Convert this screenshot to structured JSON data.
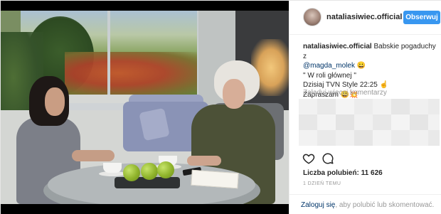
{
  "post": {
    "username": "nataliasiwiec.official",
    "follow_label": "Obserwuj",
    "caption": {
      "username": "nataliasiwiec.official",
      "text_1": "Babskie pogaduchy z",
      "mention": "@magda_molek",
      "emoji_1": "😀",
      "line_2": "\" W roli głównej \"",
      "line_3": "Dzisiaj TVN Style 22:25",
      "emoji_2": "☝",
      "line_4": "Zapraszam",
      "emoji_3": "😀💥"
    },
    "load_more_label": "Załaduj więcej komentarzy",
    "likes": {
      "label": "Liczba polubień:",
      "count": "11 626"
    },
    "timestamp": "1 DZIEŃ TEMU",
    "footer": {
      "login_link": "Zaloguj się",
      "rest": ", aby polubić lub skomentować."
    }
  },
  "icons": {
    "like": "heart-icon",
    "comment": "comment-icon"
  },
  "colors": {
    "accent": "#3897f0",
    "link": "#003569",
    "muted": "#999999"
  }
}
